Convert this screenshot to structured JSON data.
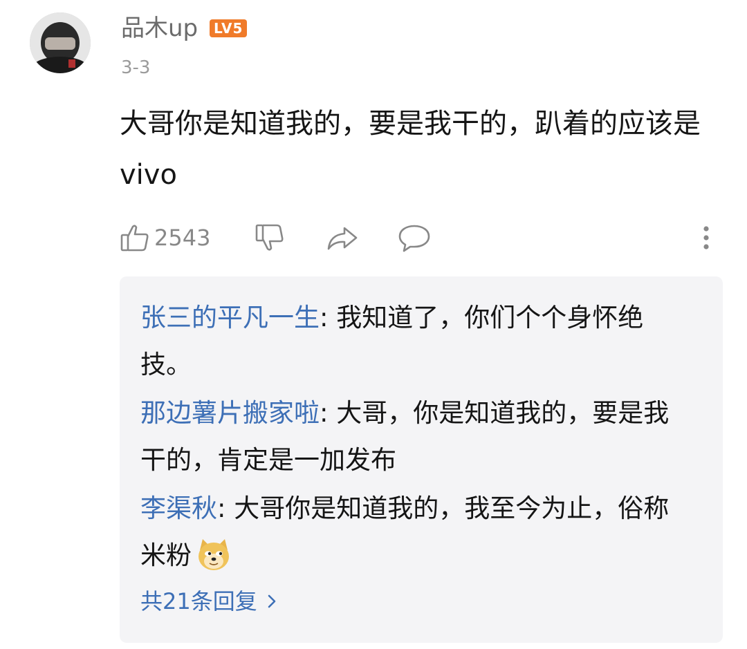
{
  "comment": {
    "username": "品木up",
    "level": "LV5",
    "date": "3-3",
    "text": "大哥你是知道我的，要是我干的，趴着的应该是vivo",
    "likes": "2543"
  },
  "icons": {
    "like": "thumbs-up-icon",
    "dislike": "thumbs-down-icon",
    "share": "share-icon",
    "reply": "comment-bubble-icon",
    "more": "more-vertical-icon",
    "emoji": "doge-emoji-icon"
  },
  "replies": [
    {
      "author": "张三的平凡一生",
      "text": "我知道了，你们个个身怀绝技。"
    },
    {
      "author": "那边薯片搬家啦",
      "text": "大哥，你是知道我的，要是我干的，肯定是一加发布"
    },
    {
      "author": "李渠秋",
      "text": "大哥你是知道我的，我至今为止，俗称米粉"
    }
  ],
  "more_replies_label": "共21条回复",
  "colors": {
    "link": "#3d6fb6",
    "level_badge": "#f07b2a",
    "reply_bg": "#f4f4f6"
  }
}
